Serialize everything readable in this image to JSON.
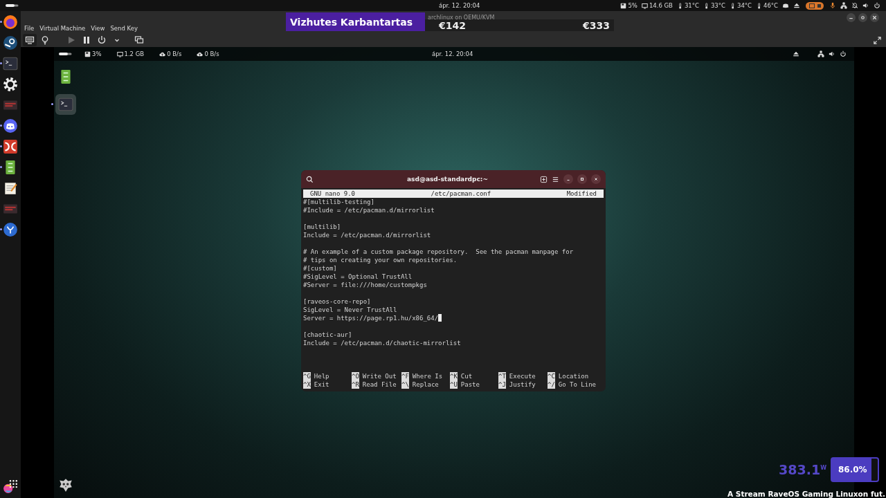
{
  "host_top_bar": {
    "date": "ápr. 12. 20:04",
    "stats": [
      {
        "kind": "disk",
        "text": "5%"
      },
      {
        "kind": "memory",
        "text": "14.6 GB"
      },
      {
        "kind": "temp",
        "text": "31°C"
      },
      {
        "kind": "temp",
        "text": "33°C"
      },
      {
        "kind": "temp",
        "text": "34°C"
      },
      {
        "kind": "temp",
        "text": "46°C"
      }
    ]
  },
  "host_dock": [
    {
      "kind": "browser",
      "running": true
    },
    {
      "kind": "store",
      "running": false
    },
    {
      "kind": "terminal",
      "running": true
    },
    {
      "kind": "settings",
      "running": false
    },
    {
      "kind": "game",
      "running": false
    },
    {
      "kind": "chat",
      "running": true
    },
    {
      "kind": "media",
      "running": true
    },
    {
      "kind": "files",
      "running": true
    },
    {
      "kind": "notes",
      "running": false
    },
    {
      "kind": "game",
      "running": false
    },
    {
      "kind": "editor",
      "running": true
    }
  ],
  "stream_overlay": {
    "title": "Vizhutes Karbantartas",
    "amounts": [
      "€142",
      "€333"
    ]
  },
  "vm_window": {
    "title": "archlinux on QEMU/KVM",
    "menu": [
      "File",
      "Virtual Machine",
      "View",
      "Send Key"
    ],
    "toolbar": [
      {
        "kind": "monitor",
        "selected": true,
        "disabled": false
      },
      {
        "kind": "bulb",
        "selected": false,
        "disabled": false
      },
      {
        "kind": "play",
        "selected": false,
        "disabled": true
      },
      {
        "kind": "pause",
        "selected": false,
        "disabled": false
      },
      {
        "kind": "power",
        "selected": false,
        "disabled": false
      },
      {
        "kind": "caret",
        "selected": false,
        "disabled": false
      },
      {
        "kind": "screens",
        "selected": false,
        "disabled": false
      }
    ]
  },
  "guest_top_bar": {
    "date": "ápr. 12. 20:04",
    "stats": [
      {
        "kind": "disk",
        "text": "3%"
      },
      {
        "kind": "memory",
        "text": "1.2 GB"
      },
      {
        "kind": "upload",
        "text": "0 B/s"
      },
      {
        "kind": "upload",
        "text": "0 B/s"
      }
    ]
  },
  "guest_dock": [
    {
      "kind": "files",
      "selected": false
    },
    {
      "kind": "terminal",
      "selected": true
    }
  ],
  "terminal": {
    "title": "asd@asd-standardpc:~",
    "nano_header": {
      "version": "GNU nano 9.0",
      "file": "/etc/pacman.conf",
      "status": "Modified"
    },
    "blocks": [
      [
        {
          "text": "#[multilib-testing]",
          "cursor": false
        },
        {
          "text": "#Include = /etc/pacman.d/mirrorlist",
          "cursor": false
        }
      ],
      [
        {
          "text": "[multilib]",
          "cursor": false
        },
        {
          "text": "Include = /etc/pacman.d/mirrorlist",
          "cursor": false
        }
      ],
      [
        {
          "text": "# An example of a custom package repository.  See the pacman manpage for",
          "cursor": false
        },
        {
          "text": "# tips on creating your own repositories.",
          "cursor": false
        },
        {
          "text": "#[custom]",
          "cursor": false
        },
        {
          "text": "#SigLevel = Optional TrustAll",
          "cursor": false
        },
        {
          "text": "#Server = file:///home/custompkgs",
          "cursor": false
        }
      ],
      [
        {
          "text": "[raveos-core-repo]",
          "cursor": false
        },
        {
          "text": "SigLevel = Never TrustAll",
          "cursor": false
        },
        {
          "text": "Server = https://page.rp1.hu/x86_64/",
          "cursor": true
        }
      ],
      [
        {
          "text": "[chaotic-aur]",
          "cursor": false
        },
        {
          "text": "Include = /etc/pacman.d/chaotic-mirrorlist",
          "cursor": false
        }
      ]
    ],
    "shortcuts": [
      {
        "key": "^G",
        "label": "Help"
      },
      {
        "key": "^O",
        "label": "Write Out"
      },
      {
        "key": "^F",
        "label": "Where Is"
      },
      {
        "key": "^K",
        "label": "Cut"
      },
      {
        "key": "^T",
        "label": "Execute"
      },
      {
        "key": "^C",
        "label": "Location"
      },
      {
        "key": "^X",
        "label": "Exit"
      },
      {
        "key": "^R",
        "label": "Read File"
      },
      {
        "key": "^\\",
        "label": "Replace"
      },
      {
        "key": "^U",
        "label": "Paste"
      },
      {
        "key": "^J",
        "label": "Justify"
      },
      {
        "key": "^/",
        "label": "Go To Line"
      }
    ]
  },
  "power_overlay": {
    "watts": "383.1",
    "unit": "W",
    "battery": {
      "text": "86.0%",
      "level": 0.86
    },
    "caption": "A Stream RaveOS Gaming Linuxon fut."
  }
}
